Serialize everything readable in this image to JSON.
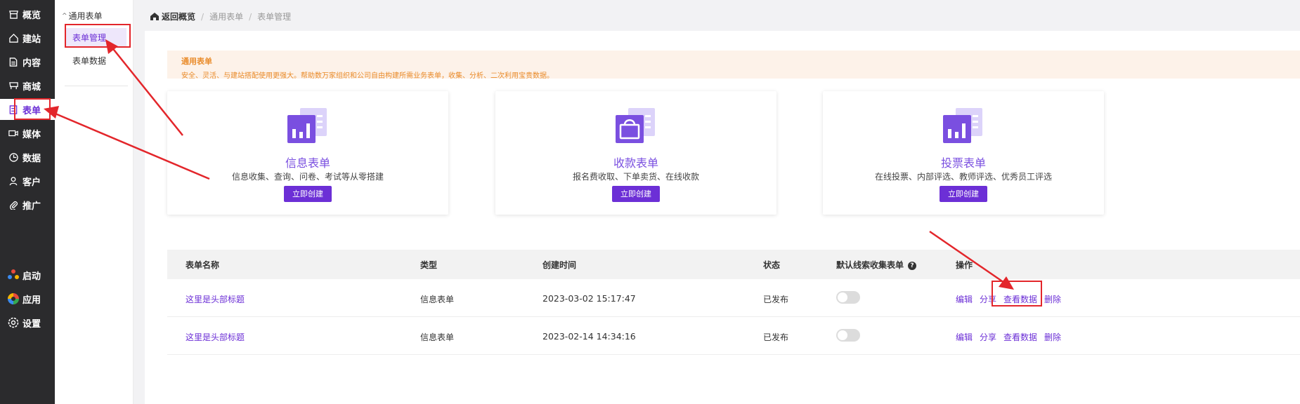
{
  "nav": {
    "items": [
      {
        "label": "概览",
        "icon": "shop-icon"
      },
      {
        "label": "建站",
        "icon": "home-icon"
      },
      {
        "label": "内容",
        "icon": "document-icon"
      },
      {
        "label": "商城",
        "icon": "cart-icon"
      },
      {
        "label": "表单",
        "icon": "form-icon"
      },
      {
        "label": "媒体",
        "icon": "video-icon"
      },
      {
        "label": "数据",
        "icon": "chart-icon"
      },
      {
        "label": "客户",
        "icon": "user-icon"
      },
      {
        "label": "推广",
        "icon": "paperclip-icon"
      }
    ],
    "bottom": [
      {
        "label": "启动",
        "icon": "dots-icon"
      },
      {
        "label": "应用",
        "icon": "apps-icon"
      },
      {
        "label": "设置",
        "icon": "gear-icon"
      }
    ]
  },
  "subnav": {
    "header": "通用表单",
    "items": [
      "表单管理",
      "表单数据"
    ]
  },
  "breadcrumb": {
    "back": "返回概览",
    "level1": "通用表单",
    "level2": "表单管理"
  },
  "notice": {
    "title": "通用表单",
    "desc": "安全、灵活、与建站搭配使用更强大。帮助数万家组织和公司自由构建所需业务表单，收集、分析、二次利用宝贵数据。"
  },
  "cards": [
    {
      "title": "信息表单",
      "desc": "信息收集、查询、问卷、考试等从零搭建",
      "button": "立即创建"
    },
    {
      "title": "收款表单",
      "desc": "报名费收取、下单卖货、在线收款",
      "button": "立即创建"
    },
    {
      "title": "投票表单",
      "desc": "在线投票、内部评选、教师评选、优秀员工评选",
      "button": "立即创建"
    }
  ],
  "table": {
    "headers": [
      "表单名称",
      "类型",
      "创建时间",
      "状态",
      "默认线索收集表单",
      "操作"
    ],
    "rows": [
      {
        "name": "这里是头部标题",
        "type": "信息表单",
        "created": "2023-03-02 15:17:47",
        "status": "已发布",
        "toggle": false
      },
      {
        "name": "这里是头部标题",
        "type": "信息表单",
        "created": "2023-02-14 14:34:16",
        "status": "已发布",
        "toggle": false
      }
    ],
    "ops": [
      "编辑",
      "分享",
      "查看数据",
      "删除"
    ]
  },
  "colors": {
    "accent": "#6c2fd6",
    "nav_bg": "#2b2b2d",
    "annotation": "#e3262b",
    "notice_text": "#e98b2a"
  }
}
